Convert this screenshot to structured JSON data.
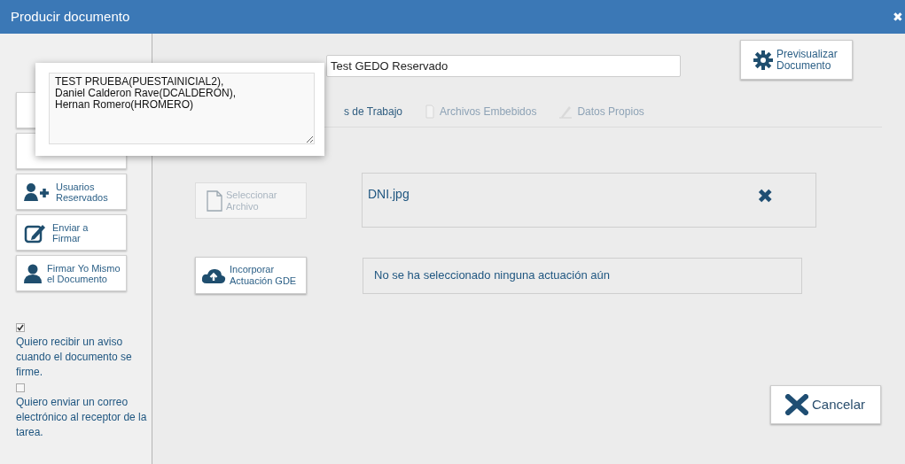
{
  "window": {
    "title": "Producir documento",
    "close": "✖"
  },
  "popup": {
    "lines": [
      "TEST PRUEBA(PUESTAINICIAL2),",
      "Daniel Calderon Rave(DCALDERON),",
      "Hernan Romero(HROMERO)"
    ]
  },
  "sidebar": {
    "buttons": [
      {
        "kind": "hidden"
      },
      {
        "kind": "hidden"
      },
      {
        "kind": "users",
        "label": "Usuarios\nReservados"
      },
      {
        "kind": "sign",
        "label": "Enviar a\nFirmar"
      },
      {
        "kind": "user",
        "label": "Firmar Yo Mismo\nel Documento"
      }
    ],
    "options": [
      {
        "label": "Quiero recibir un aviso cuando el documento se firme.",
        "checked": true
      },
      {
        "label": "Quiero enviar un correo electrónico al receptor de la tarea.",
        "checked": false
      }
    ]
  },
  "reference": {
    "value": "Test GEDO Reservado"
  },
  "preview_button": "Previsualizar\nDocumento",
  "tabs": [
    {
      "label": "s de Trabajo",
      "disabled": false,
      "kind": "plain"
    },
    {
      "label": "Archivos Embebidos",
      "disabled": true,
      "kind": "file"
    },
    {
      "label": "Datos Propios",
      "disabled": true,
      "kind": "pencil"
    }
  ],
  "select_file": {
    "label": "Seleccionar\nArchivo",
    "disabled": true
  },
  "file": {
    "name": "DNI.jpg",
    "remove": "✖"
  },
  "incorporate": {
    "label": "Incorporar\nActuación GDE"
  },
  "actuacion": {
    "text": "No se ha seleccionado ninguna actuación aún"
  },
  "cancel": {
    "label": "Cancelar"
  }
}
